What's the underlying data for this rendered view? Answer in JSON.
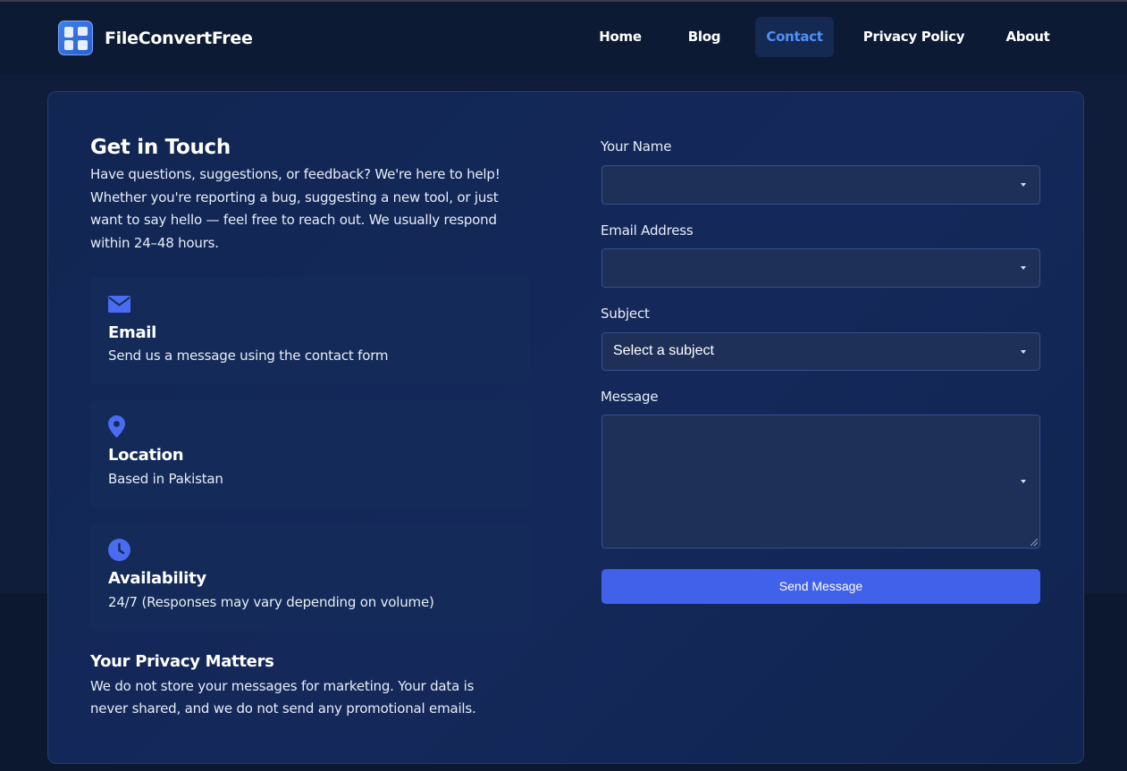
{
  "brand": {
    "name": "FileConvertFree",
    "logo_icon": "file-convert-logo-icon"
  },
  "nav": {
    "items": [
      {
        "label": "Home",
        "active": false
      },
      {
        "label": "Blog",
        "active": false
      },
      {
        "label": "Contact",
        "active": true
      },
      {
        "label": "Privacy Policy",
        "active": false
      },
      {
        "label": "About",
        "active": false
      }
    ]
  },
  "contact": {
    "heading": "Get in Touch",
    "intro": "Have questions, suggestions, or feedback? We're here to help! Whether you're reporting a bug, suggesting a new tool, or just want to say hello — feel free to reach out. We usually respond within 24–48 hours.",
    "cards": [
      {
        "icon": "envelope-icon",
        "title": "Email",
        "description": "Send us a message using the contact form"
      },
      {
        "icon": "map-pin-icon",
        "title": "Location",
        "description": "Based in Pakistan"
      },
      {
        "icon": "clock-icon",
        "title": "Availability",
        "description": "24/7 (Responses may vary depending on volume)"
      }
    ],
    "privacy": {
      "heading": "Your Privacy Matters",
      "text": "We do not store your messages for marketing. Your data is never shared, and we do not send any promotional emails."
    }
  },
  "form": {
    "name_label": "Your Name",
    "name_value": "",
    "email_label": "Email Address",
    "email_value": "",
    "subject_label": "Subject",
    "subject_value": "Select a subject",
    "message_label": "Message",
    "message_value": "",
    "submit_label": "Send Message"
  },
  "colors": {
    "background": "#0f1d3a",
    "navbar": "#0c1a33",
    "accent": "#4261ea",
    "active_link": "#4f8ff7",
    "icon_blue": "#4a6cf0"
  }
}
